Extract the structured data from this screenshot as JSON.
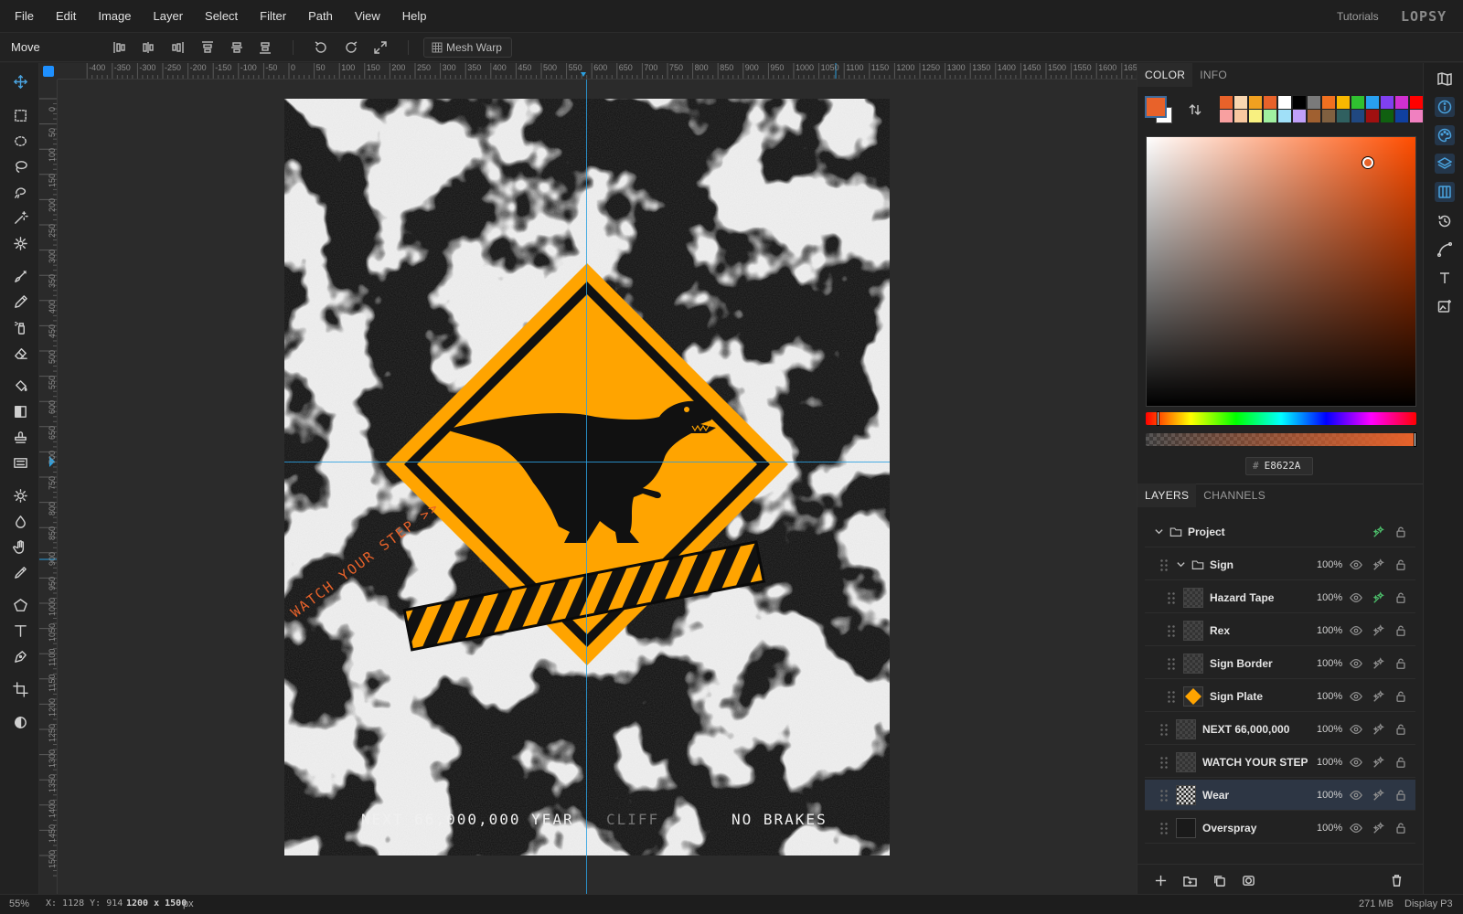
{
  "menu": {
    "items": [
      "File",
      "Edit",
      "Image",
      "Layer",
      "Select",
      "Filter",
      "Path",
      "View",
      "Help"
    ],
    "tutorials": "Tutorials",
    "logo": "LOPSY"
  },
  "toolbar": {
    "tool_name": "Move",
    "mesh_warp": "Mesh Warp"
  },
  "ruler": {
    "top_labels": [
      "-400",
      "-350",
      "-300",
      "-250",
      "-200",
      "-150",
      "-100",
      "-50",
      "0",
      "50",
      "100",
      "150",
      "200",
      "250",
      "300",
      "350",
      "400",
      "450",
      "500",
      "550",
      "600",
      "650",
      "700",
      "750",
      "800",
      "850",
      "900",
      "950",
      "1000",
      "1050",
      "1100",
      "1150",
      "1200",
      "1250",
      "1300",
      "1350",
      "1400",
      "1450",
      "1500",
      "1550",
      "1600",
      "1650"
    ],
    "left_labels": [
      "0",
      "50",
      "100",
      "150",
      "200",
      "250",
      "300",
      "350",
      "400",
      "450",
      "500",
      "550",
      "600",
      "650",
      "700",
      "750",
      "800",
      "850",
      "900",
      "950",
      "1000",
      "1050",
      "1100",
      "1150",
      "1200",
      "1250",
      "1300",
      "1350",
      "1400",
      "1450",
      "1500"
    ]
  },
  "artwork": {
    "side_text": "WATCH YOUR STEP >>",
    "bottom_left": "NEXT 66,000,000 YEAR",
    "bottom_mid": "CLIFF",
    "bottom_right": "NO BRAKES",
    "colors": {
      "sign": "#FFA400",
      "ink": "#111111",
      "accent": "#E8622A"
    }
  },
  "color_panel": {
    "tabs": [
      "COLOR",
      "INFO"
    ],
    "foreground": "#E8622A",
    "background": "#FFFFFF",
    "hex_prefix": "#",
    "hex": "E8622A",
    "swatches": [
      "#e8622a",
      "#f8d6b0",
      "#f0a020",
      "#e8622a",
      "#ffffff",
      "#000000",
      "#7a7a7a",
      "#f07020",
      "#f8b800",
      "#30c030",
      "#28a0f0",
      "#8040f0",
      "#d030d0",
      "#ff0000",
      "#f8a0a0",
      "#f8c8a0",
      "#f8f080",
      "#a0f0a0",
      "#a0e0f8",
      "#c0a0f8",
      "#a06030",
      "#806040",
      "#306060",
      "#204880",
      "#a01010",
      "#106010",
      "#1040a0",
      "#f080c0"
    ]
  },
  "layers_panel": {
    "tabs": [
      "LAYERS",
      "CHANNELS"
    ],
    "rows": [
      {
        "name": "Project",
        "opacity": "",
        "type": "group",
        "indent": 0
      },
      {
        "name": "Sign",
        "opacity": "100%",
        "type": "group",
        "indent": 1
      },
      {
        "name": "Hazard Tape",
        "opacity": "100%",
        "type": "layer",
        "indent": 2
      },
      {
        "name": "Rex",
        "opacity": "100%",
        "type": "layer",
        "indent": 2
      },
      {
        "name": "Sign Border",
        "opacity": "100%",
        "type": "layer",
        "indent": 2
      },
      {
        "name": "Sign Plate",
        "opacity": "100%",
        "type": "layer",
        "indent": 2
      },
      {
        "name": "NEXT 66,000,000",
        "opacity": "100%",
        "type": "layer",
        "indent": 1
      },
      {
        "name": "WATCH YOUR STEP",
        "opacity": "100%",
        "type": "layer",
        "indent": 1
      },
      {
        "name": "Wear",
        "opacity": "100%",
        "type": "layer",
        "indent": 1,
        "selected": true
      },
      {
        "name": "Overspray",
        "opacity": "100%",
        "type": "layer",
        "indent": 1
      }
    ]
  },
  "status": {
    "zoom": "55%",
    "cursor": "X: 1128 Y: 914",
    "doc_size": "1200 x 1500",
    "doc_unit": "px",
    "memory": "271 MB",
    "display": "Display P3"
  }
}
